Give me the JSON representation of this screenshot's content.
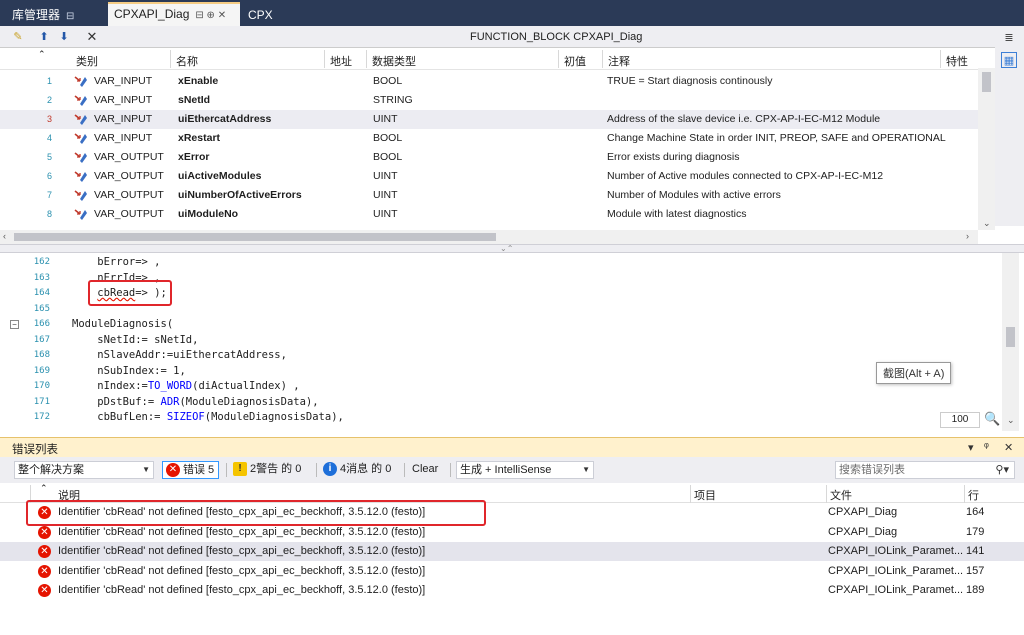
{
  "tabs": [
    {
      "label": "库管理器",
      "glyph": "⊟"
    },
    {
      "label": "CPXAPI_Diag",
      "glyph": "⊟  ⊕  ✕"
    },
    {
      "label": "CPX",
      "glyph": ""
    }
  ],
  "declaration": {
    "title": "FUNCTION_BLOCK CPXAPI_Diag",
    "columns": [
      "类别",
      "名称",
      "地址",
      "数据类型",
      "初值",
      "注释",
      "特性"
    ],
    "rows": [
      {
        "no": "1",
        "cls": "VAR_INPUT",
        "name": "xEnable",
        "type": "BOOL",
        "comment": "TRUE = Start diagnosis continously"
      },
      {
        "no": "2",
        "cls": "VAR_INPUT",
        "name": "sNetId",
        "type": "STRING",
        "comment": ""
      },
      {
        "no": "3",
        "cls": "VAR_INPUT",
        "name": "uiEthercatAddress",
        "type": "UINT",
        "comment": "Address of the slave device i.e. CPX-AP-I-EC-M12 Module"
      },
      {
        "no": "4",
        "cls": "VAR_INPUT",
        "name": "xRestart",
        "type": "BOOL",
        "comment": "Change Machine State in order INIT, PREOP, SAFE and OPERATIONAL"
      },
      {
        "no": "5",
        "cls": "VAR_OUTPUT",
        "name": "xError",
        "type": "BOOL",
        "comment": "Error exists during diagnosis"
      },
      {
        "no": "6",
        "cls": "VAR_OUTPUT",
        "name": "uiActiveModules",
        "type": "UINT",
        "comment": "Number of Active modules connected to CPX-AP-I-EC-M12"
      },
      {
        "no": "7",
        "cls": "VAR_OUTPUT",
        "name": "uiNumberOfActiveErrors",
        "type": "UINT",
        "comment": "Number of Modules with active errors"
      },
      {
        "no": "8",
        "cls": "VAR_OUTPUT",
        "name": "uiModuleNo",
        "type": "UINT",
        "comment": "Module with latest diagnostics"
      }
    ]
  },
  "code": {
    "lines": [
      {
        "no": "162",
        "text": "    bError=> ,"
      },
      {
        "no": "163",
        "text": "    nErrId=> ,"
      },
      {
        "no": "164",
        "text": "    cbRead=> );"
      },
      {
        "no": "165",
        "text": ""
      },
      {
        "no": "166",
        "text": "ModuleDiagnosis("
      },
      {
        "no": "167",
        "text": "    sNetId:= sNetId,"
      },
      {
        "no": "168",
        "text": "    nSlaveAddr:=uiEthercatAddress,"
      },
      {
        "no": "169",
        "text": "    nSubIndex:= 1,"
      },
      {
        "no": "170",
        "text": "    nIndex:=TO_WORD(diActualIndex) ,"
      },
      {
        "no": "171",
        "text": "    pDstBuf:= ADR(ModuleDiagnosisData),"
      },
      {
        "no": "172",
        "text": "    cbBufLen:= SIZEOF(ModuleDiagnosisData),"
      }
    ],
    "tooltip": "截图(Alt + A)",
    "zoom": "100"
  },
  "error_list": {
    "title": "错误列表",
    "scope": "整个解决方案",
    "errors_label": "错误 5",
    "warnings_label": "2警告 的 0",
    "messages_label": "4消息 的 0",
    "clear_label": "Clear",
    "build_filter": "生成 + IntelliSense",
    "search_placeholder": "搜索错误列表",
    "columns": [
      "说明",
      "项目",
      "文件",
      "行"
    ],
    "rows": [
      {
        "desc": "Identifier 'cbRead' not defined [festo_cpx_api_ec_beckhoff, 3.5.12.0 (festo)]",
        "file": "CPXAPI_Diag",
        "line": "164"
      },
      {
        "desc": "Identifier 'cbRead' not defined [festo_cpx_api_ec_beckhoff, 3.5.12.0 (festo)]",
        "file": "CPXAPI_Diag",
        "line": "179"
      },
      {
        "desc": "Identifier 'cbRead' not defined [festo_cpx_api_ec_beckhoff, 3.5.12.0 (festo)]",
        "file": "CPXAPI_IOLink_Paramet...",
        "line": "141"
      },
      {
        "desc": "Identifier 'cbRead' not defined [festo_cpx_api_ec_beckhoff, 3.5.12.0 (festo)]",
        "file": "CPXAPI_IOLink_Paramet...",
        "line": "157"
      },
      {
        "desc": "Identifier 'cbRead' not defined [festo_cpx_api_ec_beckhoff, 3.5.12.0 (festo)]",
        "file": "CPXAPI_IOLink_Paramet...",
        "line": "189"
      }
    ]
  },
  "colors": {
    "accent": "#2b3a57",
    "error": "#e51400",
    "highlight": "#e0262b",
    "panel_title": "#fff1cd"
  }
}
